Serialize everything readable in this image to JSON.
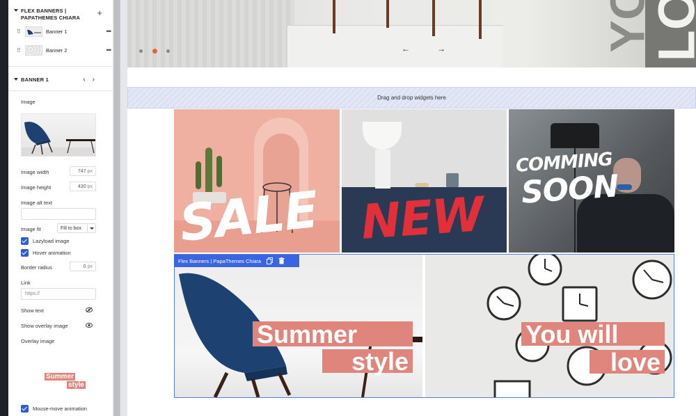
{
  "sidebar": {
    "section_title_line1": "FLEX BANNERS |",
    "section_title_line2": "PAPATHEMES CHIARA",
    "add_icon": "plus-icon",
    "banners": [
      {
        "label": "Banner 1"
      },
      {
        "label": "Banner 2"
      }
    ],
    "banner_section_title": "BANNER 1",
    "image_label": "Image",
    "image_width_label": "Image width",
    "image_width_value": "747",
    "image_height_label": "Image height",
    "image_height_value": "430",
    "unit_px": "px",
    "image_alt_label": "Image alt text",
    "image_alt_value": "",
    "image_fit_label": "Image fit",
    "image_fit_value": "Fill to box",
    "lazyload_label": "Lazyload image",
    "hover_label": "Hover animation",
    "border_radius_label": "Border radius",
    "border_radius_value": "0",
    "link_label": "Link",
    "link_placeholder": "https://",
    "show_text_label": "Show text",
    "show_overlay_label": "Show overlay image",
    "overlay_image_label": "Overlay image",
    "overlay_text_line1": "Summer",
    "overlay_text_line2": "style",
    "mouse_move_label": "Mouse-move animation"
  },
  "canvas": {
    "hero_text": "YO",
    "hero_text2": "LO",
    "slider_prev": "←",
    "slider_next": "→",
    "dropzone_text": "Drag and drop widgets here",
    "tiles": [
      {
        "word": "SALE"
      },
      {
        "word": "NEW"
      },
      {
        "word_line1": "COMMING",
        "word_line2": "SOON"
      }
    ],
    "widget_bar_label": "Flex Banners | PapaThemes Chiara",
    "banner1_line1": "Summer",
    "banner1_line2": "style",
    "banner2_line1": "You will",
    "banner2_line2": "love"
  },
  "colors": {
    "accent": "#3b64e0",
    "salmon": "#e0857b",
    "active_dot": "#e8622c"
  }
}
